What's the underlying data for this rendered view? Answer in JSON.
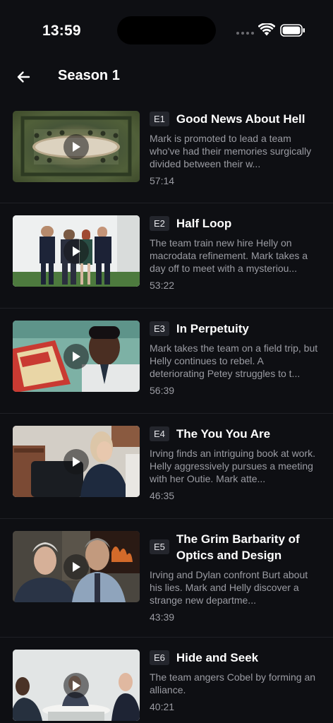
{
  "status_bar": {
    "time": "13:59"
  },
  "header": {
    "title": "Season 1"
  },
  "episodes": [
    {
      "badge": "E1",
      "title": "Good News About Hell",
      "description": "Mark is promoted to lead a team who've had their memories surgically divided between their w...",
      "duration": "57:14"
    },
    {
      "badge": "E2",
      "title": "Half Loop",
      "description": "The team train new hire Helly on macrodata refinement. Mark takes a day off to meet with a mysteriou...",
      "duration": "53:22"
    },
    {
      "badge": "E3",
      "title": "In Perpetuity",
      "description": "Mark takes the team on a field trip, but Helly continues to rebel. A deteriorating Petey struggles to t...",
      "duration": "56:39"
    },
    {
      "badge": "E4",
      "title": "The You You Are",
      "description": "Irving finds an intriguing book at work. Helly aggressively pursues a meeting with her Outie. Mark atte...",
      "duration": "46:35"
    },
    {
      "badge": "E5",
      "title": "The Grim Barbarity of Optics and Design",
      "description": "Irving and Dylan confront Burt about his lies. Mark and Helly discover a strange new departme...",
      "duration": "43:39"
    },
    {
      "badge": "E6",
      "title": "Hide and Seek",
      "description": "The team angers Cobel by forming an alliance.",
      "duration": "40:21"
    }
  ]
}
